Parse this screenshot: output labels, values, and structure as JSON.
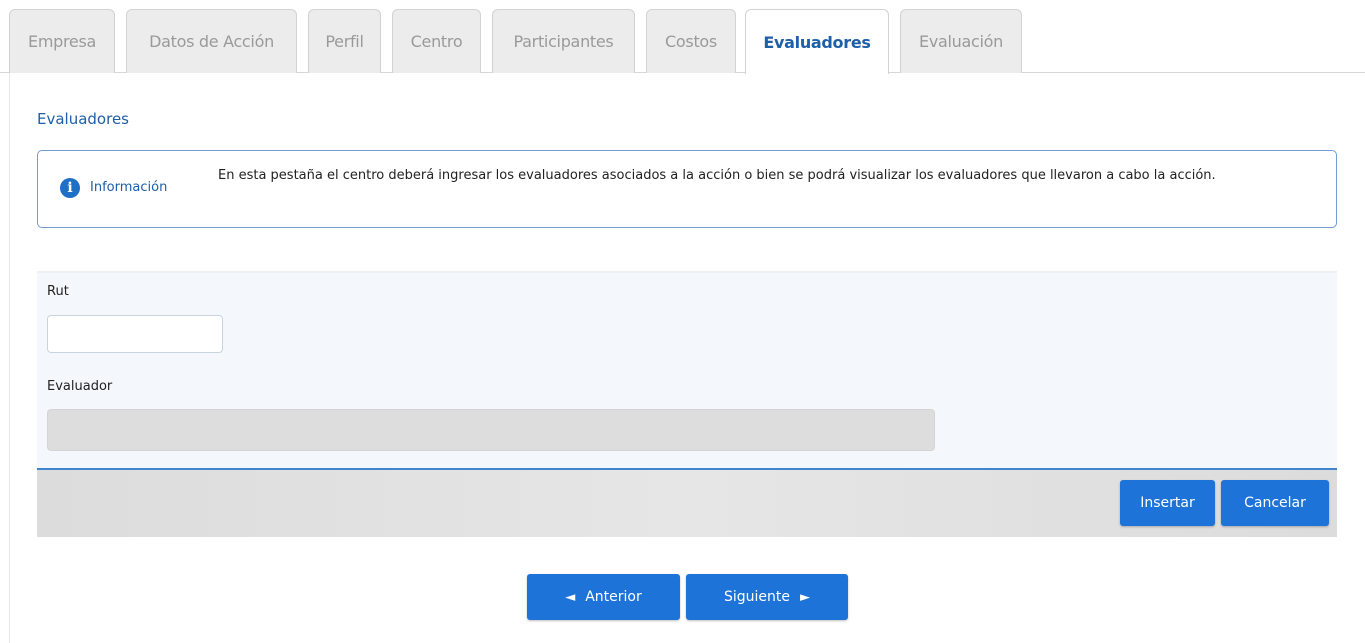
{
  "tabs": [
    {
      "label": "Empresa"
    },
    {
      "label": "Datos de Acción"
    },
    {
      "label": "Perfil"
    },
    {
      "label": "Centro"
    },
    {
      "label": "Participantes"
    },
    {
      "label": "Costos"
    },
    {
      "label": "Evaluadores"
    },
    {
      "label": "Evaluación"
    }
  ],
  "active_tab": "Evaluadores",
  "section": {
    "title": "Evaluadores"
  },
  "info": {
    "icon": "info-icon",
    "label": "Información",
    "text": "En esta pestaña el centro deberá ingresar los evaluadores asociados a la acción o bien se podrá visualizar los evaluadores que llevaron a cabo la acción."
  },
  "form": {
    "rut_label": "Rut",
    "rut_value": "",
    "evaluador_label": "Evaluador",
    "evaluador_value": ""
  },
  "actions": {
    "insert_label": "Insertar",
    "cancel_label": "Cancelar"
  },
  "nav": {
    "prev_label": "Anterior",
    "prev_arrow": "◄",
    "next_label": "Siguiente",
    "next_arrow": "►"
  },
  "colors": {
    "accent": "#1e73d8",
    "title": "#1d5fa8",
    "panel": "#f4f7fc"
  }
}
